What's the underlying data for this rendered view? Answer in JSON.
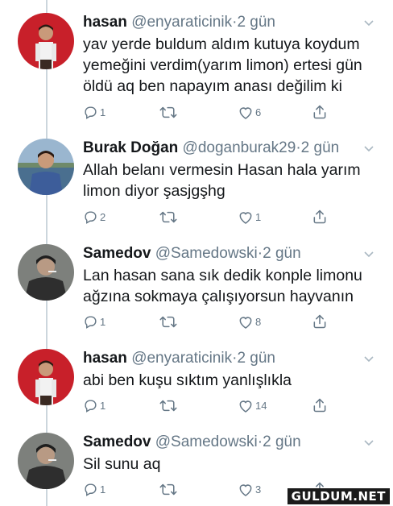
{
  "tweets": [
    {
      "name": "hasan",
      "handle": "@enyaraticinik",
      "dot": "·",
      "time": "2 gün",
      "lines": [
        "yav yerde buldum aldım kutuya koydum",
        "yemeğini verdim(yarım limon) ertesi gün",
        "öldü aq ben napayım anası değilim ki"
      ],
      "replies": "1",
      "retweets": "",
      "likes": "6",
      "avatar": "red-background-man"
    },
    {
      "name": "Burak Doğan",
      "handle": "@doganburak29",
      "dot": "·",
      "time": "2 gün",
      "lines": [
        "Allah belanı vermesin Hasan hala yarım",
        "limon diyor şasjgşhg"
      ],
      "replies": "2",
      "retweets": "",
      "likes": "1",
      "avatar": "man-by-water"
    },
    {
      "name": "Samedov",
      "handle": "@Samedowski",
      "dot": "·",
      "time": "2 gün",
      "lines": [
        "Lan hasan sana sık dedik konple limonu",
        "ağzına sokmaya çalışıyorsun hayvanın"
      ],
      "replies": "1",
      "retweets": "",
      "likes": "8",
      "avatar": "man-with-cigarette"
    },
    {
      "name": "hasan",
      "handle": "@enyaraticinik",
      "dot": "·",
      "time": "2 gün",
      "lines": [
        "abi ben kuşu sıktım yanlışlıkla"
      ],
      "replies": "1",
      "retweets": "",
      "likes": "14",
      "avatar": "red-background-man"
    },
    {
      "name": "Samedov",
      "handle": "@Samedowski",
      "dot": "·",
      "time": "2 gün",
      "lines": [
        "Sil sunu aq"
      ],
      "replies": "1",
      "retweets": "",
      "likes": "3",
      "avatar": "man-with-cigarette"
    }
  ],
  "colors": {
    "text": "#14171a",
    "secondary": "#657786",
    "thread_line": "#ccd6dd"
  },
  "watermark": "GULDUM.NET"
}
